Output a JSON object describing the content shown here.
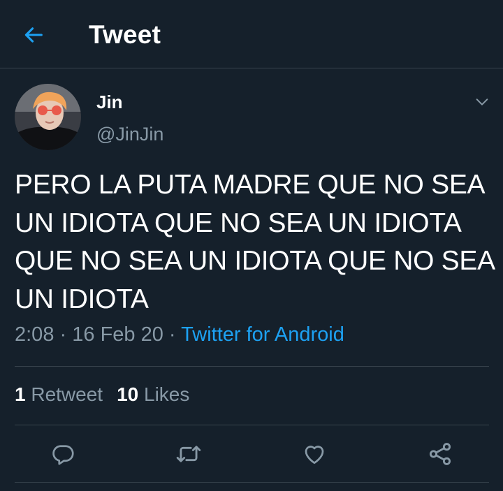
{
  "header": {
    "title": "Tweet",
    "back_icon": "arrow-left-icon"
  },
  "tweet": {
    "author_name": "Jin",
    "author_handle": "@JinJin",
    "text": "PERO LA PUTA MADRE QUE NO SEA UN IDIOTA QUE NO SEA UN IDIOTA QUE NO SEA UN IDIOTA QUE NO SEA UN IDIOTA",
    "time": "2:08",
    "separator": "·",
    "date": "16 Feb 20",
    "source": "Twitter for Android"
  },
  "stats": {
    "retweets_count": "1",
    "retweets_label": "Retweet",
    "likes_count": "10",
    "likes_label": "Likes"
  },
  "actions": {
    "reply_icon": "reply-icon",
    "retweet_icon": "retweet-icon",
    "like_icon": "heart-icon",
    "share_icon": "share-icon"
  },
  "colors": {
    "background": "#15202b",
    "accent": "#1da1f2",
    "secondary_text": "#8899a6",
    "divider": "#38444d"
  }
}
